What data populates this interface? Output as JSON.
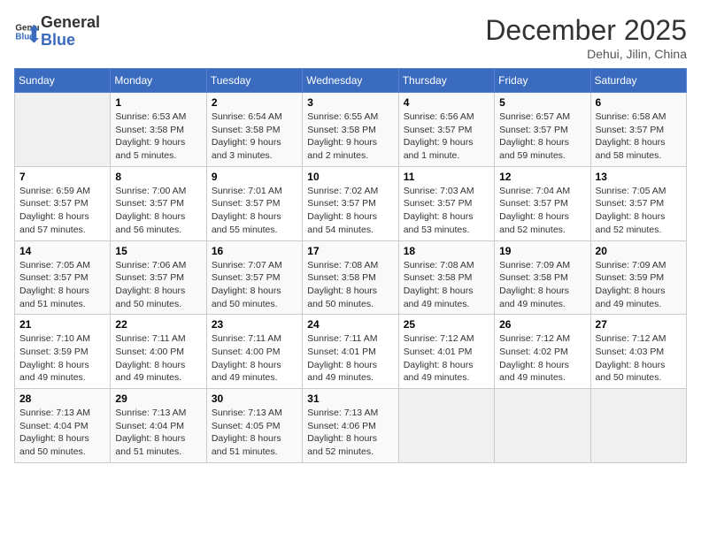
{
  "header": {
    "logo_line1": "General",
    "logo_line2": "Blue",
    "month": "December 2025",
    "location": "Dehui, Jilin, China"
  },
  "weekdays": [
    "Sunday",
    "Monday",
    "Tuesday",
    "Wednesday",
    "Thursday",
    "Friday",
    "Saturday"
  ],
  "weeks": [
    [
      {
        "day": "",
        "info": ""
      },
      {
        "day": "1",
        "info": "Sunrise: 6:53 AM\nSunset: 3:58 PM\nDaylight: 9 hours\nand 5 minutes."
      },
      {
        "day": "2",
        "info": "Sunrise: 6:54 AM\nSunset: 3:58 PM\nDaylight: 9 hours\nand 3 minutes."
      },
      {
        "day": "3",
        "info": "Sunrise: 6:55 AM\nSunset: 3:58 PM\nDaylight: 9 hours\nand 2 minutes."
      },
      {
        "day": "4",
        "info": "Sunrise: 6:56 AM\nSunset: 3:57 PM\nDaylight: 9 hours\nand 1 minute."
      },
      {
        "day": "5",
        "info": "Sunrise: 6:57 AM\nSunset: 3:57 PM\nDaylight: 8 hours\nand 59 minutes."
      },
      {
        "day": "6",
        "info": "Sunrise: 6:58 AM\nSunset: 3:57 PM\nDaylight: 8 hours\nand 58 minutes."
      }
    ],
    [
      {
        "day": "7",
        "info": "Sunrise: 6:59 AM\nSunset: 3:57 PM\nDaylight: 8 hours\nand 57 minutes."
      },
      {
        "day": "8",
        "info": "Sunrise: 7:00 AM\nSunset: 3:57 PM\nDaylight: 8 hours\nand 56 minutes."
      },
      {
        "day": "9",
        "info": "Sunrise: 7:01 AM\nSunset: 3:57 PM\nDaylight: 8 hours\nand 55 minutes."
      },
      {
        "day": "10",
        "info": "Sunrise: 7:02 AM\nSunset: 3:57 PM\nDaylight: 8 hours\nand 54 minutes."
      },
      {
        "day": "11",
        "info": "Sunrise: 7:03 AM\nSunset: 3:57 PM\nDaylight: 8 hours\nand 53 minutes."
      },
      {
        "day": "12",
        "info": "Sunrise: 7:04 AM\nSunset: 3:57 PM\nDaylight: 8 hours\nand 52 minutes."
      },
      {
        "day": "13",
        "info": "Sunrise: 7:05 AM\nSunset: 3:57 PM\nDaylight: 8 hours\nand 52 minutes."
      }
    ],
    [
      {
        "day": "14",
        "info": "Sunrise: 7:05 AM\nSunset: 3:57 PM\nDaylight: 8 hours\nand 51 minutes."
      },
      {
        "day": "15",
        "info": "Sunrise: 7:06 AM\nSunset: 3:57 PM\nDaylight: 8 hours\nand 50 minutes."
      },
      {
        "day": "16",
        "info": "Sunrise: 7:07 AM\nSunset: 3:57 PM\nDaylight: 8 hours\nand 50 minutes."
      },
      {
        "day": "17",
        "info": "Sunrise: 7:08 AM\nSunset: 3:58 PM\nDaylight: 8 hours\nand 50 minutes."
      },
      {
        "day": "18",
        "info": "Sunrise: 7:08 AM\nSunset: 3:58 PM\nDaylight: 8 hours\nand 49 minutes."
      },
      {
        "day": "19",
        "info": "Sunrise: 7:09 AM\nSunset: 3:58 PM\nDaylight: 8 hours\nand 49 minutes."
      },
      {
        "day": "20",
        "info": "Sunrise: 7:09 AM\nSunset: 3:59 PM\nDaylight: 8 hours\nand 49 minutes."
      }
    ],
    [
      {
        "day": "21",
        "info": "Sunrise: 7:10 AM\nSunset: 3:59 PM\nDaylight: 8 hours\nand 49 minutes."
      },
      {
        "day": "22",
        "info": "Sunrise: 7:11 AM\nSunset: 4:00 PM\nDaylight: 8 hours\nand 49 minutes."
      },
      {
        "day": "23",
        "info": "Sunrise: 7:11 AM\nSunset: 4:00 PM\nDaylight: 8 hours\nand 49 minutes."
      },
      {
        "day": "24",
        "info": "Sunrise: 7:11 AM\nSunset: 4:01 PM\nDaylight: 8 hours\nand 49 minutes."
      },
      {
        "day": "25",
        "info": "Sunrise: 7:12 AM\nSunset: 4:01 PM\nDaylight: 8 hours\nand 49 minutes."
      },
      {
        "day": "26",
        "info": "Sunrise: 7:12 AM\nSunset: 4:02 PM\nDaylight: 8 hours\nand 49 minutes."
      },
      {
        "day": "27",
        "info": "Sunrise: 7:12 AM\nSunset: 4:03 PM\nDaylight: 8 hours\nand 50 minutes."
      }
    ],
    [
      {
        "day": "28",
        "info": "Sunrise: 7:13 AM\nSunset: 4:04 PM\nDaylight: 8 hours\nand 50 minutes."
      },
      {
        "day": "29",
        "info": "Sunrise: 7:13 AM\nSunset: 4:04 PM\nDaylight: 8 hours\nand 51 minutes."
      },
      {
        "day": "30",
        "info": "Sunrise: 7:13 AM\nSunset: 4:05 PM\nDaylight: 8 hours\nand 51 minutes."
      },
      {
        "day": "31",
        "info": "Sunrise: 7:13 AM\nSunset: 4:06 PM\nDaylight: 8 hours\nand 52 minutes."
      },
      {
        "day": "",
        "info": ""
      },
      {
        "day": "",
        "info": ""
      },
      {
        "day": "",
        "info": ""
      }
    ]
  ]
}
